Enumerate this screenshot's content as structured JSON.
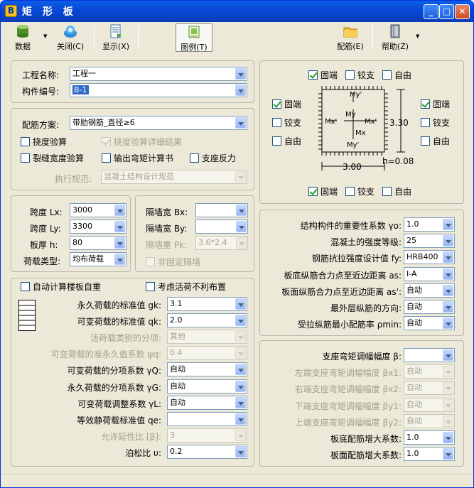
{
  "window": {
    "title": "矩 形 板",
    "app_letter": "B"
  },
  "toolbar": {
    "data": "数据",
    "close": "关闭(C)",
    "display": "显示(X)",
    "legend": "图例(T)",
    "rebar": "配筋(E)",
    "help": "帮助(Z)"
  },
  "p1": {
    "name_label": "工程名称:",
    "name_value": "工程一",
    "id_label": "构件编号:",
    "id_value": "B-1"
  },
  "p2": {
    "scheme_label": "配筋方案:",
    "scheme_value": "带肋钢筋_直径≥6",
    "deflection": "挠度验算",
    "deflection_detail": "挠度验算详细结果",
    "crack": "裂缝宽度验算",
    "output_moment": "输出弯矩计算书",
    "support_reaction": "支座反力",
    "code_label": "执行规范:",
    "code_value": "混凝土结构设计规范"
  },
  "p3": {
    "lx_label": "跨度 Lx:",
    "lx": "3000",
    "ly_label": "跨度 Ly:",
    "ly": "3300",
    "h_label": "板厚 h:",
    "h": "80",
    "load_label": "荷载类型:",
    "load": "均布荷载"
  },
  "p4": {
    "bx_label": "隔墙宽 Bx:",
    "by_label": "隔墙宽 By:",
    "pk_label": "隔墙重 Pk:",
    "pk": "3.6*2.4",
    "nonfixed": "非固定隔墙"
  },
  "p5": {
    "auto_self": "自动计算楼板自重",
    "unfav": "考虑活荷不利布置",
    "rows": [
      {
        "label": "永久荷载的标准值 gk:",
        "value": "3.1"
      },
      {
        "label": "可变荷载的标准值 qk:",
        "value": "2.0"
      },
      {
        "label": "活荷载类别的分项:",
        "value": "其他"
      },
      {
        "label": "可变荷载的准永久值系数 ψq:",
        "value": "0.4"
      },
      {
        "label": "可变荷载的分项系数 γQ:",
        "value": "自动"
      },
      {
        "label": "永久荷载的分项系数 γG:",
        "value": "自动"
      },
      {
        "label": "可变荷载调整系数 γL:",
        "value": "自动"
      },
      {
        "label": "等效静荷载标准值 qe:",
        "value": ""
      },
      {
        "label": "允许延性比 [β]:",
        "value": "3"
      },
      {
        "label": "泊松比 υ:",
        "value": "0.2"
      }
    ]
  },
  "diagram": {
    "fixed": "固端",
    "hinged": "铰支",
    "free": "自由",
    "my_top": "My'",
    "my": "My",
    "mx_left": "Mx'",
    "mx_right": "Mx'",
    "mx": "Mx",
    "my_bot": "My'",
    "dim_x": "3.00",
    "dim_y": "3.30",
    "thickness": "h=0.08"
  },
  "p7": {
    "rows": [
      {
        "label": "结构构件的重要性系数 γo:",
        "value": "1.0"
      },
      {
        "label": "混凝土的强度等级:",
        "value": "25"
      },
      {
        "label": "钢筋抗拉强度设计值 fy:",
        "value": "HRB400"
      },
      {
        "label": "板底纵筋合力点至近边距离 as:",
        "value": "Ⅰ-A"
      },
      {
        "label": "板面纵筋合力点至近边距离 as':",
        "value": "自动"
      },
      {
        "label": "最外层纵筋的方向:",
        "value": "自动"
      },
      {
        "label": "受拉纵筋最小配筋率 ρmin:",
        "value": "自动"
      }
    ]
  },
  "p8": {
    "rows": [
      {
        "label": "支座弯矩调幅幅度 β:",
        "value": ""
      },
      {
        "label": "左端支座弯矩调幅幅度 βx1:",
        "value": "自动"
      },
      {
        "label": "右端支座弯矩调幅幅度 βx2:",
        "value": "自动"
      },
      {
        "label": "下端支座弯矩调幅幅度 βy1:",
        "value": "自动"
      },
      {
        "label": "上端支座弯矩调幅幅度 βy2:",
        "value": "自动"
      },
      {
        "label": "板底配筋增大系数:",
        "value": "1.0"
      },
      {
        "label": "板面配筋增大系数:",
        "value": "1.0"
      }
    ]
  }
}
